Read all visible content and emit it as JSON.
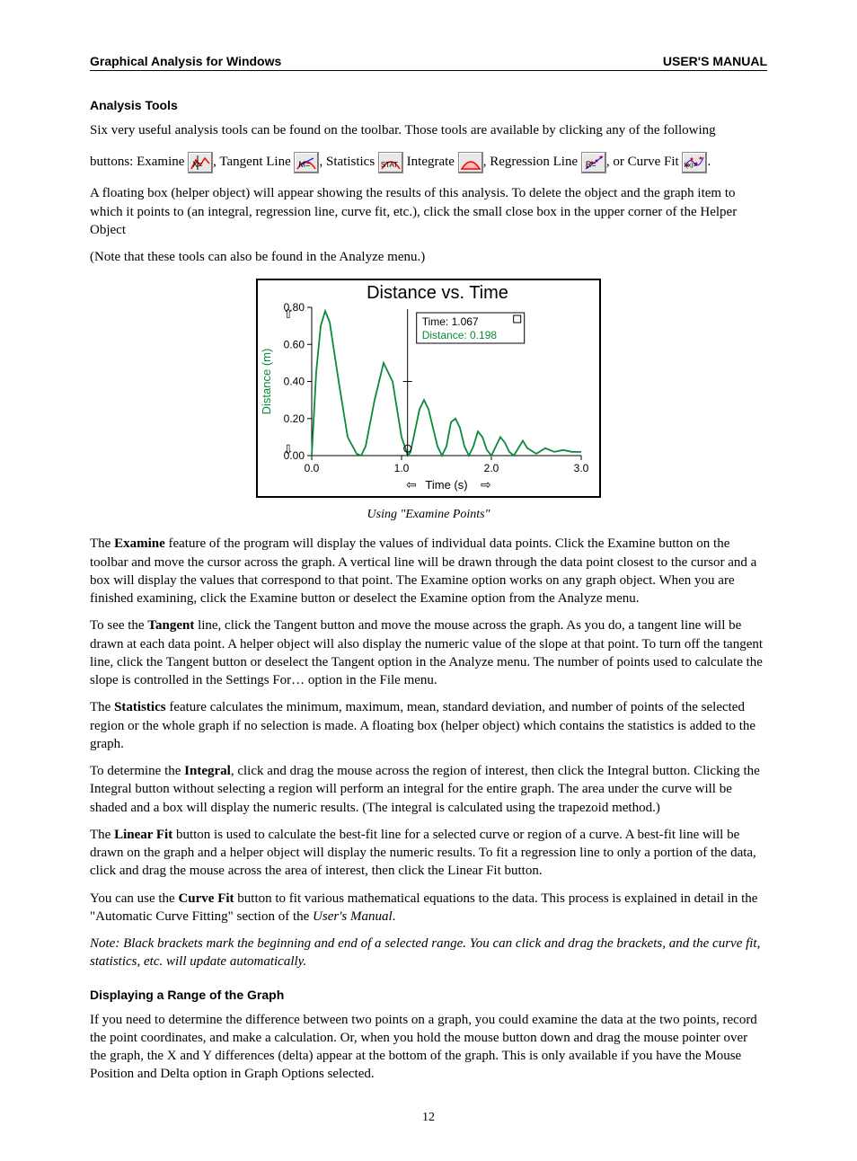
{
  "header": {
    "left": "Graphical Analysis for Windows",
    "right": "USER'S MANUAL"
  },
  "section1": {
    "title": "Analysis Tools",
    "p1": "Six very useful analysis tools can be found on the toolbar. Those tools are available by clicking any of the following",
    "buttons_prefix": "buttons: Examine ",
    "t2": ", Tangent Line ",
    "t3": ", Statistics ",
    "t4": " Integrate ",
    "t5": ", Regression Line ",
    "t6": ", or Curve Fit ",
    "t7": ".",
    "p2": "A floating box (helper object) will appear showing the results of this analysis. To delete the object and the graph item to which it points to (an integral, regression line, curve fit, etc.), click the small close box in the upper corner of the Helper Object",
    "p3": " (Note that these tools can also be found in the Analyze menu.)"
  },
  "icons": {
    "examine": "X=",
    "tangent": "M=",
    "stats": "STAT",
    "integrate": "∫",
    "regression": "R=",
    "curvefit": "f(x)="
  },
  "chart_data": {
    "type": "line",
    "title": "Distance vs. Time",
    "xlabel": "Time (s)",
    "ylabel": "Distance (m)",
    "xlim": [
      0.0,
      3.0
    ],
    "ylim": [
      0.0,
      0.8
    ],
    "xticks": [
      0.0,
      1.0,
      2.0,
      3.0
    ],
    "yticks": [
      0.0,
      0.2,
      0.4,
      0.6,
      0.8
    ],
    "examine_box": {
      "time_label": "Time: 1.067",
      "distance_label": "Distance: 0.198",
      "x": 1.067,
      "y": 0.198
    },
    "series": [
      {
        "name": "Distance",
        "x": [
          0.0,
          0.05,
          0.1,
          0.15,
          0.2,
          0.3,
          0.4,
          0.5,
          0.55,
          0.6,
          0.7,
          0.8,
          0.9,
          0.95,
          1.0,
          1.05,
          1.07,
          1.1,
          1.2,
          1.25,
          1.3,
          1.4,
          1.45,
          1.5,
          1.55,
          1.6,
          1.65,
          1.7,
          1.75,
          1.8,
          1.85,
          1.9,
          1.95,
          2.0,
          2.05,
          2.1,
          2.15,
          2.2,
          2.25,
          2.3,
          2.35,
          2.4,
          2.5,
          2.6,
          2.7,
          2.8,
          2.9,
          3.0
        ],
        "y": [
          0.0,
          0.45,
          0.7,
          0.78,
          0.72,
          0.4,
          0.1,
          0.01,
          0.0,
          0.05,
          0.3,
          0.5,
          0.4,
          0.25,
          0.1,
          0.03,
          0.0,
          0.02,
          0.25,
          0.3,
          0.25,
          0.05,
          0.0,
          0.05,
          0.18,
          0.2,
          0.15,
          0.05,
          0.0,
          0.05,
          0.13,
          0.1,
          0.03,
          0.0,
          0.05,
          0.1,
          0.07,
          0.02,
          0.0,
          0.04,
          0.08,
          0.04,
          0.01,
          0.04,
          0.02,
          0.03,
          0.02,
          0.02
        ]
      }
    ]
  },
  "figure_caption": "Using \"Examine Points\"",
  "body": {
    "p_examine_a": "The ",
    "p_examine_b": "Examine",
    "p_examine_c": " feature of the program will display the values of individual data points. Click the Examine button on the toolbar and move the cursor across the graph. A vertical line will be drawn through the data point closest to the cursor and a box will display the values that correspond to that point. The Examine option works on any graph object. When you are finished examining, click the Examine button or deselect the Examine option from the Analyze menu.",
    "p_tangent_a": "To see the ",
    "p_tangent_b": "Tangent",
    "p_tangent_c": " line, click the Tangent button and move the mouse across the graph. As you do, a tangent line will be drawn at each data point. A helper object will also display the numeric value of the slope at that point. To turn off the tangent line, click the Tangent button or deselect the Tangent option in the Analyze menu. The number of points used to calculate the slope is controlled in the Settings For… option in the File menu.",
    "p_stats_a": "The ",
    "p_stats_b": "Statistics",
    "p_stats_c": " feature calculates the minimum, maximum, mean, standard deviation, and number of points of the selected region or the whole graph if no selection is made. A floating box (helper object) which contains the statistics is added to the graph.",
    "p_integral_a": "To determine the ",
    "p_integral_b": "Integral",
    "p_integral_c": ", click and drag the mouse across the region of interest, then click the Integral button. Clicking the Integral button without selecting a region will perform an integral for the entire graph. The area under the curve will be shaded and a box will display the numeric results. (The integral is calculated using the trapezoid method.)",
    "p_linear_a": "The ",
    "p_linear_b": "Linear Fit",
    "p_linear_c": " button is used to calculate the best-fit line for a selected curve or region of a curve. A best-fit line will be drawn on the graph and a helper object will display the numeric results. To fit a regression line to only a portion of the data, click and drag the mouse across the area of interest, then click the Linear Fit button.",
    "p_curvefit_a": "You can use the ",
    "p_curvefit_b": "Curve Fit",
    "p_curvefit_c": " button to fit various mathematical equations to the data. This process is explained in detail in the \"Automatic Curve Fitting\" section of the ",
    "p_curvefit_d": "User's Manual",
    "p_curvefit_e": ".",
    "p_note": "Note: Black brackets mark the beginning and end of a selected range. You can click and drag the brackets, and the curve fit, statistics, etc. will update automatically."
  },
  "section2": {
    "title": "Displaying a Range of the Graph",
    "p1": "If you need to determine the difference between two points on a graph, you could examine the data at the two points, record the point coordinates, and make a calculation. Or, when you hold the mouse button down and drag the mouse pointer over the graph, the X and Y differences (delta) appear at the bottom of the graph. This is only available if you have the Mouse Position and Delta option in Graph Options selected."
  },
  "page_number": "12"
}
